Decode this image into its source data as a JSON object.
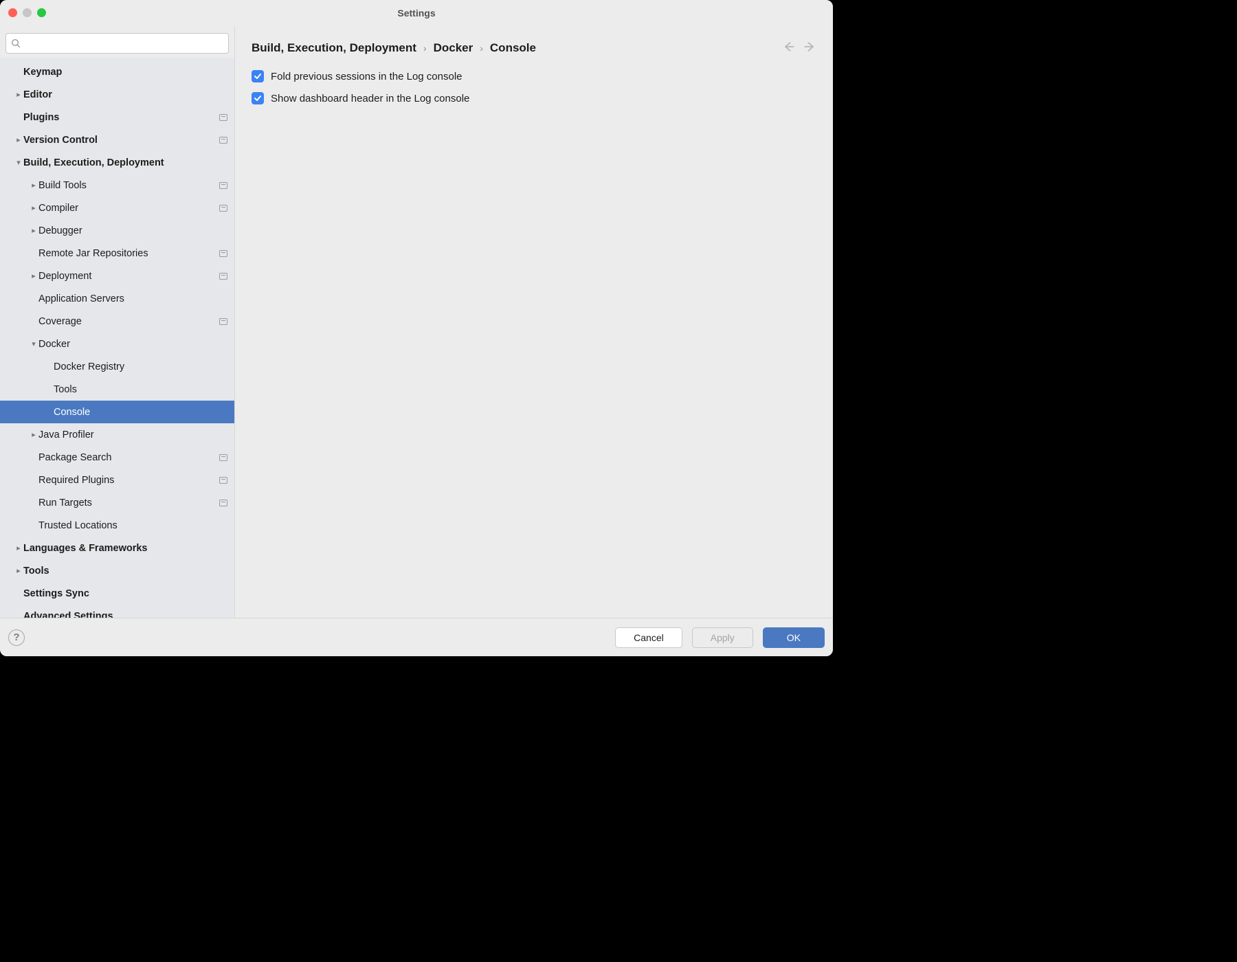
{
  "window": {
    "title": "Settings"
  },
  "search": {
    "placeholder": ""
  },
  "breadcrumb": {
    "items": [
      "Build, Execution, Deployment",
      "Docker",
      "Console"
    ]
  },
  "nav": {
    "back_enabled": false,
    "fwd_enabled": false
  },
  "sidebar": {
    "items": [
      {
        "label": "Keymap",
        "level": 0,
        "bold": true,
        "arrow": "",
        "mod": false
      },
      {
        "label": "Editor",
        "level": 0,
        "bold": true,
        "arrow": "right",
        "mod": false
      },
      {
        "label": "Plugins",
        "level": 0,
        "bold": true,
        "arrow": "",
        "mod": true
      },
      {
        "label": "Version Control",
        "level": 0,
        "bold": true,
        "arrow": "right",
        "mod": true
      },
      {
        "label": "Build, Execution, Deployment",
        "level": 0,
        "bold": true,
        "arrow": "down",
        "mod": false
      },
      {
        "label": "Build Tools",
        "level": 1,
        "bold": false,
        "arrow": "right",
        "mod": true
      },
      {
        "label": "Compiler",
        "level": 1,
        "bold": false,
        "arrow": "right",
        "mod": true
      },
      {
        "label": "Debugger",
        "level": 1,
        "bold": false,
        "arrow": "right",
        "mod": false
      },
      {
        "label": "Remote Jar Repositories",
        "level": 1,
        "bold": false,
        "arrow": "",
        "mod": true
      },
      {
        "label": "Deployment",
        "level": 1,
        "bold": false,
        "arrow": "right",
        "mod": true
      },
      {
        "label": "Application Servers",
        "level": 1,
        "bold": false,
        "arrow": "",
        "mod": false
      },
      {
        "label": "Coverage",
        "level": 1,
        "bold": false,
        "arrow": "",
        "mod": true
      },
      {
        "label": "Docker",
        "level": 1,
        "bold": false,
        "arrow": "down",
        "mod": false
      },
      {
        "label": "Docker Registry",
        "level": 2,
        "bold": false,
        "arrow": "",
        "mod": false
      },
      {
        "label": "Tools",
        "level": 2,
        "bold": false,
        "arrow": "",
        "mod": false
      },
      {
        "label": "Console",
        "level": 2,
        "bold": false,
        "arrow": "",
        "mod": false,
        "selected": true
      },
      {
        "label": "Java Profiler",
        "level": 1,
        "bold": false,
        "arrow": "right",
        "mod": false
      },
      {
        "label": "Package Search",
        "level": 1,
        "bold": false,
        "arrow": "",
        "mod": true
      },
      {
        "label": "Required Plugins",
        "level": 1,
        "bold": false,
        "arrow": "",
        "mod": true
      },
      {
        "label": "Run Targets",
        "level": 1,
        "bold": false,
        "arrow": "",
        "mod": true
      },
      {
        "label": "Trusted Locations",
        "level": 1,
        "bold": false,
        "arrow": "",
        "mod": false
      },
      {
        "label": "Languages & Frameworks",
        "level": 0,
        "bold": true,
        "arrow": "right",
        "mod": false
      },
      {
        "label": "Tools",
        "level": 0,
        "bold": true,
        "arrow": "right",
        "mod": false
      },
      {
        "label": "Settings Sync",
        "level": 0,
        "bold": true,
        "arrow": "",
        "mod": false
      },
      {
        "label": "Advanced Settings",
        "level": 0,
        "bold": true,
        "arrow": "",
        "mod": false
      }
    ]
  },
  "options": [
    {
      "label": "Fold previous sessions in the Log console",
      "checked": true
    },
    {
      "label": "Show dashboard header in the Log console",
      "checked": true
    }
  ],
  "footer": {
    "cancel": "Cancel",
    "apply": "Apply",
    "ok": "OK",
    "apply_enabled": false
  }
}
